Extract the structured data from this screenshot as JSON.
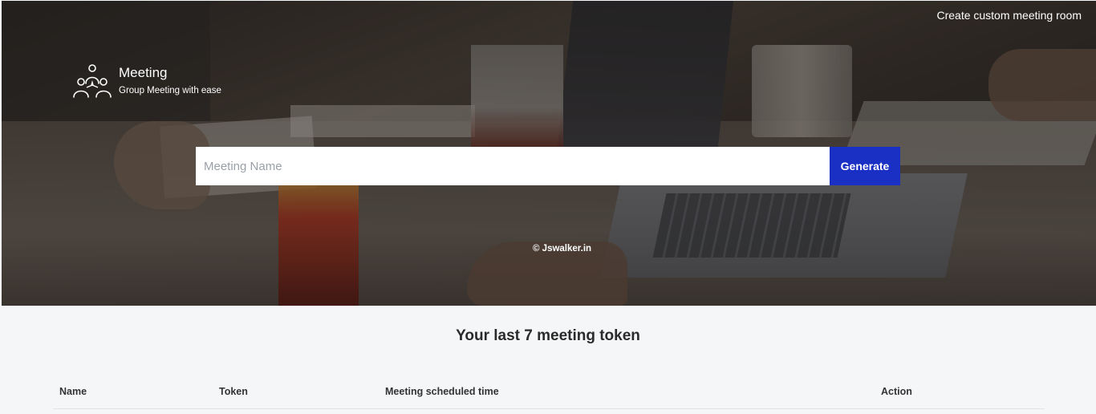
{
  "header": {
    "custom_room_link": "Create custom meeting room"
  },
  "brand": {
    "title": "Meeting",
    "subtitle": "Group Meeting with ease",
    "icon": "group-people-icon"
  },
  "form": {
    "placeholder": "Meeting Name",
    "value": "",
    "generate_label": "Generate"
  },
  "hero": {
    "credit": "© Jswalker.in"
  },
  "tokens": {
    "heading": "Your last 7 meeting token",
    "columns": [
      "Name",
      "Token",
      "Meeting scheduled time",
      "Action"
    ]
  },
  "colors": {
    "accent": "#1a2fc4",
    "section_bg": "#f5f6f8"
  }
}
